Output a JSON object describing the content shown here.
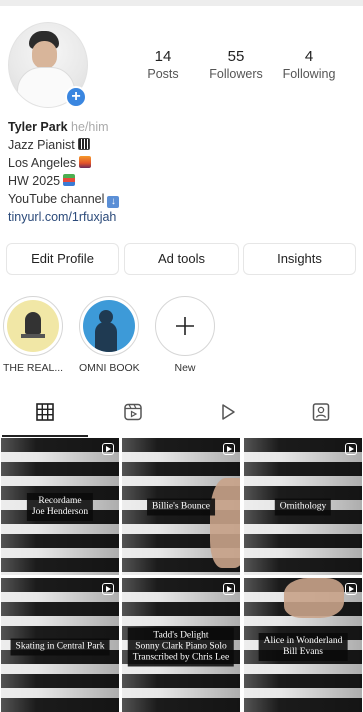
{
  "profile": {
    "name": "Tyler Park",
    "pronouns": "he/him",
    "bio_lines": [
      {
        "text": "Jazz Pianist",
        "emoji": "piano-emoji"
      },
      {
        "text": "Los Angeles",
        "emoji": "sunset-city-emoji"
      },
      {
        "text": "HW 2025",
        "emoji": "books-emoji"
      },
      {
        "text": "YouTube channel",
        "emoji": "down-arrow-emoji"
      }
    ],
    "link": "tinyurl.com/1rfuxjah"
  },
  "stats": [
    {
      "value": "14",
      "label": "Posts"
    },
    {
      "value": "55",
      "label": "Followers"
    },
    {
      "value": "4",
      "label": "Following"
    }
  ],
  "buttons": {
    "edit_profile": "Edit Profile",
    "ad_tools": "Ad tools",
    "insights": "Insights"
  },
  "highlights": [
    {
      "label": "THE REAL..."
    },
    {
      "label": "OMNI BOOK"
    },
    {
      "label": "New"
    }
  ],
  "tabs": [
    {
      "icon": "grid-icon"
    },
    {
      "icon": "reels-icon"
    },
    {
      "icon": "play-icon"
    },
    {
      "icon": "tagged-icon"
    }
  ],
  "grid_posts": [
    {
      "caption_lines": [
        "Recordame",
        "Joe Henderson"
      ]
    },
    {
      "caption_lines": [
        "Billie's Bounce"
      ]
    },
    {
      "caption_lines": [
        "Ornithology"
      ]
    },
    {
      "caption_lines": [
        "Skating in Central Park"
      ]
    },
    {
      "caption_lines": [
        "Tadd's Delight",
        "Sonny Clark Piano Solo",
        "Transcribed by Chris Lee"
      ]
    },
    {
      "caption_lines": [
        "Alice in Wonderland",
        "Bill Evans"
      ]
    }
  ],
  "colors": {
    "accent_blue": "#3a86e0",
    "link": "#2b4a7a",
    "caption_bg": "#0a0a0a"
  }
}
